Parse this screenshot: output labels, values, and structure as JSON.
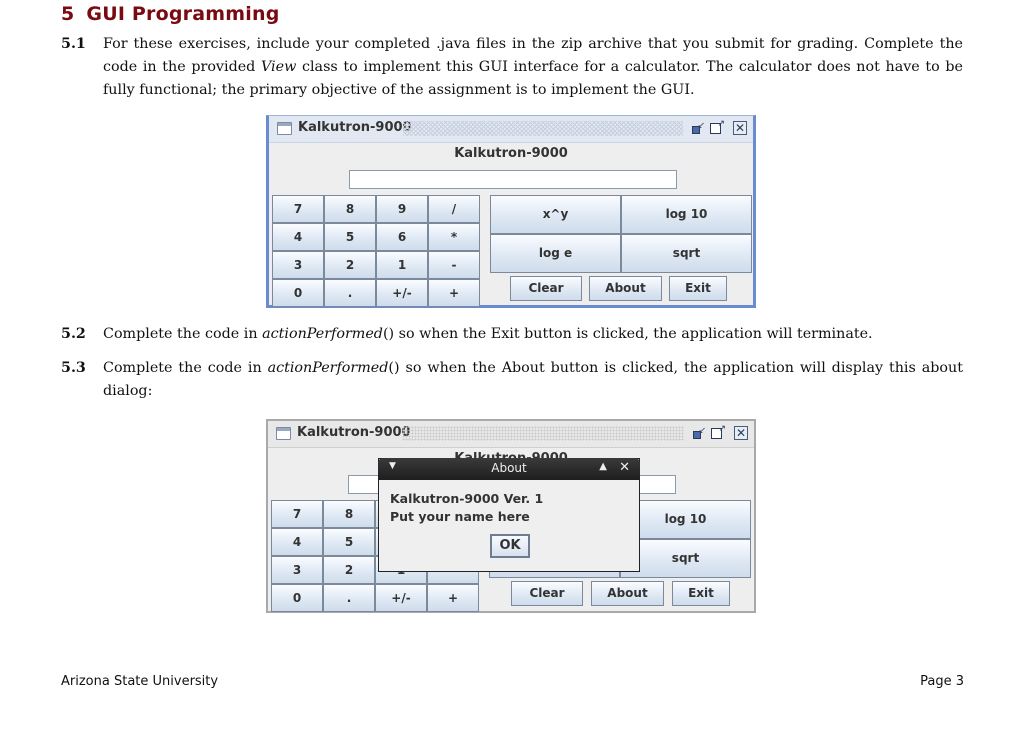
{
  "section": {
    "number": "5",
    "title": "GUI Programming"
  },
  "exercises": [
    {
      "number": "5.1",
      "text_parts": [
        "For these exercises, include your completed .java files in the zip archive that you submit for grading. Complete the code in the provided ",
        "View",
        " class to implement this GUI interface for a calculator. The calculator does not have to be fully functional; the primary objective of the assignment is to implement the GUI."
      ]
    },
    {
      "number": "5.2",
      "text_parts": [
        "Complete the code in ",
        "actionPerformed",
        "() so when the Exit button is clicked, the application will terminate."
      ]
    },
    {
      "number": "5.3",
      "text_parts": [
        "Complete the code in ",
        "actionPerformed",
        "() so when the About button is clicked, the application will display this about dialog:"
      ]
    }
  ],
  "calculator_window": {
    "title": "Kalkutron-9000",
    "label": "Kalkutron-9000",
    "display_value": "",
    "title_icons": [
      "window-icon",
      "iconify-icon",
      "maximize-icon",
      "close-icon"
    ],
    "keypad": [
      [
        "7",
        "8",
        "9",
        "/"
      ],
      [
        "4",
        "5",
        "6",
        "*"
      ],
      [
        "3",
        "2",
        "1",
        "-"
      ],
      [
        "0",
        ".",
        "+/-",
        "+"
      ]
    ],
    "functions": [
      [
        "x^y",
        "log 10"
      ],
      [
        "log e",
        "sqrt"
      ]
    ],
    "controls": [
      "Clear",
      "About",
      "Exit"
    ]
  },
  "about_dialog": {
    "title": "About",
    "line1": "Kalkutron-9000 Ver. 1",
    "line2": "Put your name here",
    "ok_label": "OK",
    "title_icons": [
      "menu-icon",
      "shade-icon",
      "close-icon"
    ]
  },
  "footer": {
    "left": "Arizona State University",
    "right": "Page 3"
  }
}
